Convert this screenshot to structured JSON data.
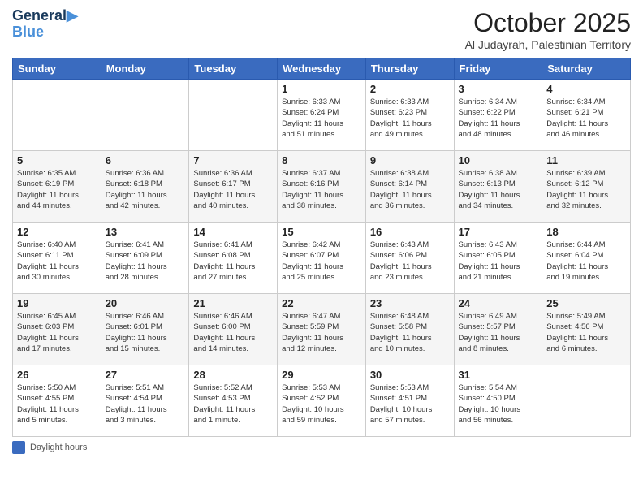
{
  "logo": {
    "line1": "General",
    "line2": "Blue"
  },
  "title": "October 2025",
  "subtitle": "Al Judayrah, Palestinian Territory",
  "headers": [
    "Sunday",
    "Monday",
    "Tuesday",
    "Wednesday",
    "Thursday",
    "Friday",
    "Saturday"
  ],
  "weeks": [
    [
      {
        "day": "",
        "info": ""
      },
      {
        "day": "",
        "info": ""
      },
      {
        "day": "",
        "info": ""
      },
      {
        "day": "1",
        "info": "Sunrise: 6:33 AM\nSunset: 6:24 PM\nDaylight: 11 hours\nand 51 minutes."
      },
      {
        "day": "2",
        "info": "Sunrise: 6:33 AM\nSunset: 6:23 PM\nDaylight: 11 hours\nand 49 minutes."
      },
      {
        "day": "3",
        "info": "Sunrise: 6:34 AM\nSunset: 6:22 PM\nDaylight: 11 hours\nand 48 minutes."
      },
      {
        "day": "4",
        "info": "Sunrise: 6:34 AM\nSunset: 6:21 PM\nDaylight: 11 hours\nand 46 minutes."
      }
    ],
    [
      {
        "day": "5",
        "info": "Sunrise: 6:35 AM\nSunset: 6:19 PM\nDaylight: 11 hours\nand 44 minutes."
      },
      {
        "day": "6",
        "info": "Sunrise: 6:36 AM\nSunset: 6:18 PM\nDaylight: 11 hours\nand 42 minutes."
      },
      {
        "day": "7",
        "info": "Sunrise: 6:36 AM\nSunset: 6:17 PM\nDaylight: 11 hours\nand 40 minutes."
      },
      {
        "day": "8",
        "info": "Sunrise: 6:37 AM\nSunset: 6:16 PM\nDaylight: 11 hours\nand 38 minutes."
      },
      {
        "day": "9",
        "info": "Sunrise: 6:38 AM\nSunset: 6:14 PM\nDaylight: 11 hours\nand 36 minutes."
      },
      {
        "day": "10",
        "info": "Sunrise: 6:38 AM\nSunset: 6:13 PM\nDaylight: 11 hours\nand 34 minutes."
      },
      {
        "day": "11",
        "info": "Sunrise: 6:39 AM\nSunset: 6:12 PM\nDaylight: 11 hours\nand 32 minutes."
      }
    ],
    [
      {
        "day": "12",
        "info": "Sunrise: 6:40 AM\nSunset: 6:11 PM\nDaylight: 11 hours\nand 30 minutes."
      },
      {
        "day": "13",
        "info": "Sunrise: 6:41 AM\nSunset: 6:09 PM\nDaylight: 11 hours\nand 28 minutes."
      },
      {
        "day": "14",
        "info": "Sunrise: 6:41 AM\nSunset: 6:08 PM\nDaylight: 11 hours\nand 27 minutes."
      },
      {
        "day": "15",
        "info": "Sunrise: 6:42 AM\nSunset: 6:07 PM\nDaylight: 11 hours\nand 25 minutes."
      },
      {
        "day": "16",
        "info": "Sunrise: 6:43 AM\nSunset: 6:06 PM\nDaylight: 11 hours\nand 23 minutes."
      },
      {
        "day": "17",
        "info": "Sunrise: 6:43 AM\nSunset: 6:05 PM\nDaylight: 11 hours\nand 21 minutes."
      },
      {
        "day": "18",
        "info": "Sunrise: 6:44 AM\nSunset: 6:04 PM\nDaylight: 11 hours\nand 19 minutes."
      }
    ],
    [
      {
        "day": "19",
        "info": "Sunrise: 6:45 AM\nSunset: 6:03 PM\nDaylight: 11 hours\nand 17 minutes."
      },
      {
        "day": "20",
        "info": "Sunrise: 6:46 AM\nSunset: 6:01 PM\nDaylight: 11 hours\nand 15 minutes."
      },
      {
        "day": "21",
        "info": "Sunrise: 6:46 AM\nSunset: 6:00 PM\nDaylight: 11 hours\nand 14 minutes."
      },
      {
        "day": "22",
        "info": "Sunrise: 6:47 AM\nSunset: 5:59 PM\nDaylight: 11 hours\nand 12 minutes."
      },
      {
        "day": "23",
        "info": "Sunrise: 6:48 AM\nSunset: 5:58 PM\nDaylight: 11 hours\nand 10 minutes."
      },
      {
        "day": "24",
        "info": "Sunrise: 6:49 AM\nSunset: 5:57 PM\nDaylight: 11 hours\nand 8 minutes."
      },
      {
        "day": "25",
        "info": "Sunrise: 5:49 AM\nSunset: 4:56 PM\nDaylight: 11 hours\nand 6 minutes."
      }
    ],
    [
      {
        "day": "26",
        "info": "Sunrise: 5:50 AM\nSunset: 4:55 PM\nDaylight: 11 hours\nand 5 minutes."
      },
      {
        "day": "27",
        "info": "Sunrise: 5:51 AM\nSunset: 4:54 PM\nDaylight: 11 hours\nand 3 minutes."
      },
      {
        "day": "28",
        "info": "Sunrise: 5:52 AM\nSunset: 4:53 PM\nDaylight: 11 hours\nand 1 minute."
      },
      {
        "day": "29",
        "info": "Sunrise: 5:53 AM\nSunset: 4:52 PM\nDaylight: 10 hours\nand 59 minutes."
      },
      {
        "day": "30",
        "info": "Sunrise: 5:53 AM\nSunset: 4:51 PM\nDaylight: 10 hours\nand 57 minutes."
      },
      {
        "day": "31",
        "info": "Sunrise: 5:54 AM\nSunset: 4:50 PM\nDaylight: 10 hours\nand 56 minutes."
      },
      {
        "day": "",
        "info": ""
      }
    ]
  ],
  "footer": {
    "daylight_label": "Daylight hours"
  }
}
